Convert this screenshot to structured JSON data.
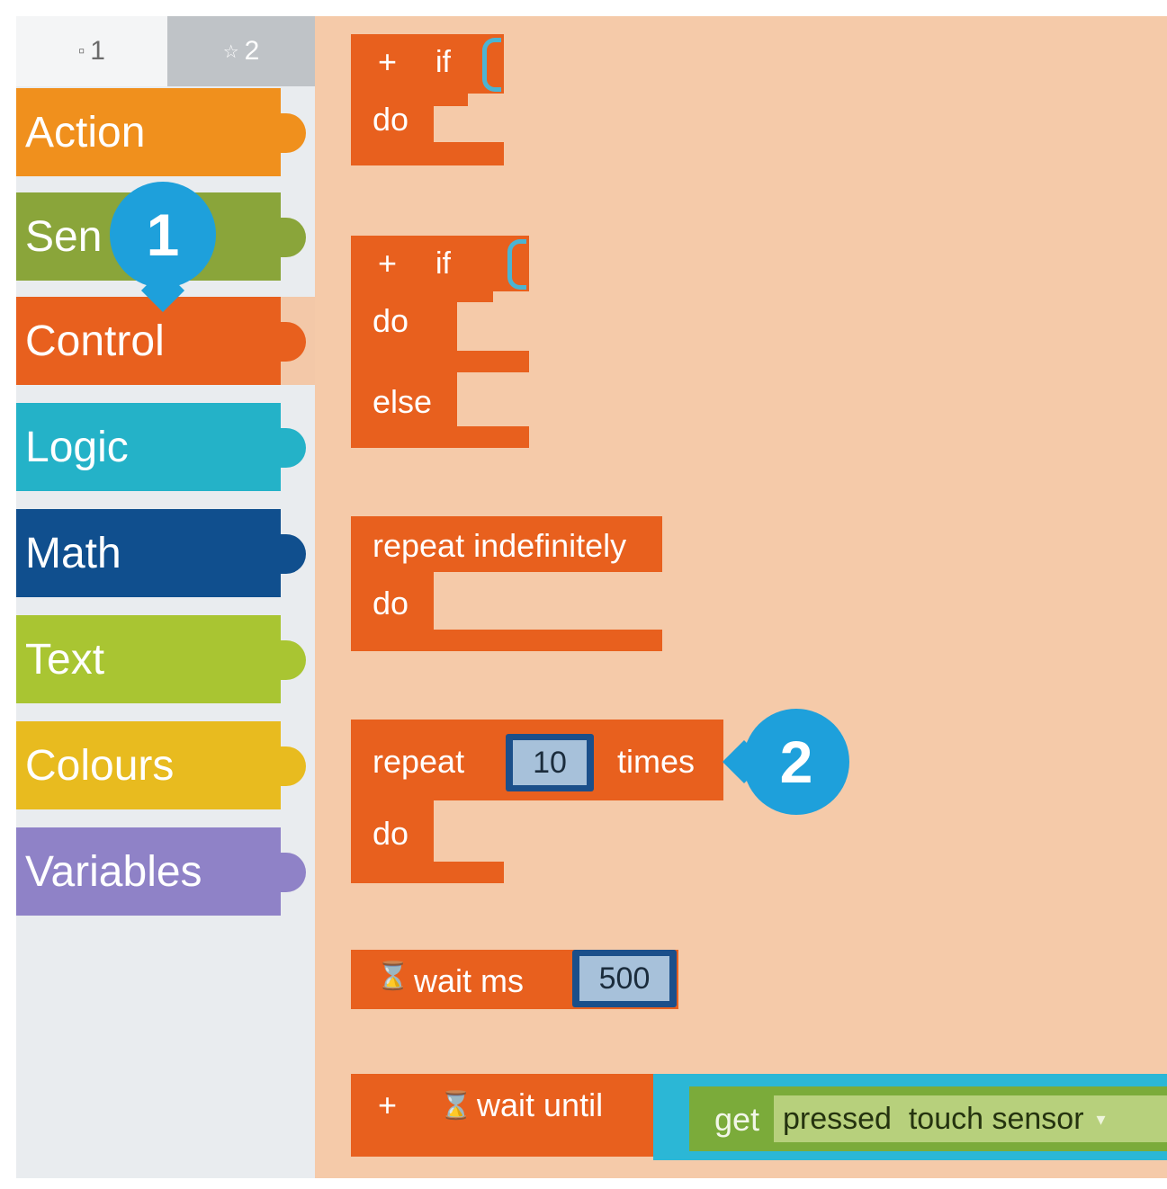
{
  "toolbox": {
    "tabs": [
      {
        "icon": "square-icon",
        "label": "1"
      },
      {
        "icon": "star-icon",
        "label": "2"
      }
    ],
    "categories": [
      {
        "label": "Action",
        "color": "#f0901d"
      },
      {
        "label": "Sen",
        "color": "#8aa53a"
      },
      {
        "label": "Control",
        "color": "#e8601e",
        "selected": true
      },
      {
        "label": "Logic",
        "color": "#24b2c8"
      },
      {
        "label": "Math",
        "color": "#104f8e"
      },
      {
        "label": "Text",
        "color": "#a9c532"
      },
      {
        "label": "Colours",
        "color": "#e8bb1f"
      },
      {
        "label": "Variables",
        "color": "#8f82c7"
      }
    ]
  },
  "workspace": {
    "background": "#f5caa9",
    "block_color": "#e8601e",
    "if_block": {
      "plus": "+",
      "if": "if",
      "do": "do"
    },
    "if_else_block": {
      "plus": "+",
      "if": "if",
      "do": "do",
      "else": "else"
    },
    "repeat_forever": {
      "label": "repeat indefinitely",
      "do": "do"
    },
    "repeat_times": {
      "repeat": "repeat",
      "count": "10",
      "times": "times",
      "do": "do"
    },
    "wait_ms": {
      "icon": "hourglass-icon",
      "label": "wait ms",
      "value": "500"
    },
    "wait_until": {
      "plus": "+",
      "icon": "hourglass-icon",
      "label": "wait until",
      "get": "get",
      "field": "pressed  touch sensor",
      "dropdown": "▾"
    }
  },
  "callouts": [
    {
      "number": "1",
      "color": "#1ea0db"
    },
    {
      "number": "2",
      "color": "#1ea0db"
    }
  ]
}
